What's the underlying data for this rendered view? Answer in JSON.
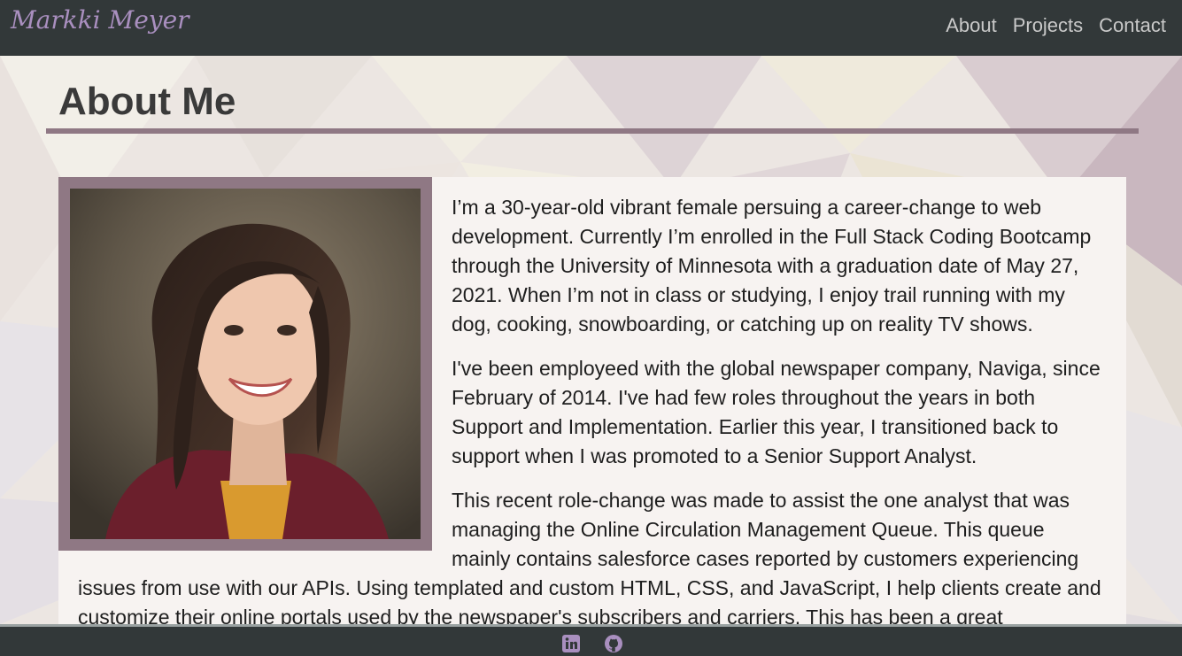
{
  "header": {
    "brand": "Markki Meyer",
    "nav": [
      {
        "label": "About"
      },
      {
        "label": "Projects"
      },
      {
        "label": "Contact"
      }
    ]
  },
  "main": {
    "title": "About Me",
    "paragraphs": [
      "I’m a 30-year-old vibrant female persuing a career-change to web development. Currently I’m enrolled in the Full Stack Coding Bootcamp through the University of Minnesota with a graduation date of May 27, 2021. When I’m not in class or studying, I enjoy trail running with my dog, cooking, snowboarding, or catching up on reality TV shows.",
      "I've been employeed with the global newspaper company, Naviga, since February of 2014. I've had few roles throughout the years in both Support and Implementation. Earlier this year, I transitioned back to support when I was promoted to a Senior Support Analyst.",
      "This recent role-change was made to assist the one analyst that was managing the Online Circulation Management Queue. This queue mainly contains salesforce cases reported by customers experiencing issues from use with our APIs. Using templated and custom HTML, CSS, and JavaScript, I help clients create and customize their online portals used by the newspaper's subscribers and carriers. This has been a great"
    ]
  },
  "footer": {
    "icons": [
      "linkedin-icon",
      "github-icon"
    ]
  },
  "colors": {
    "header_bg": "#323839",
    "brand": "#a98fbf",
    "accent_frame": "#8f7884",
    "panel_bg": "#f7f3f1",
    "footer_icon": "#a98fbf"
  }
}
